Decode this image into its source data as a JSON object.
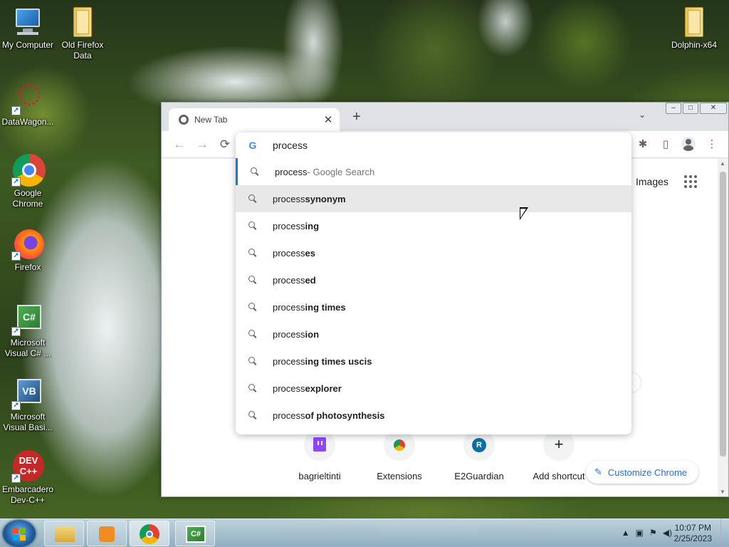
{
  "desktop": {
    "icons": [
      {
        "name": "My Computer",
        "label": "My Computer"
      },
      {
        "name": "Old Firefox Data",
        "label": "Old Firefox Data"
      },
      {
        "name": "DataWagon",
        "label": "DataWagon..."
      },
      {
        "name": "Google Chrome",
        "label": "Google Chrome"
      },
      {
        "name": "Firefox",
        "label": "Firefox"
      },
      {
        "name": "Microsoft Visual C#",
        "label": "Microsoft Visual C# ..."
      },
      {
        "name": "Microsoft Visual Basic",
        "label": "Microsoft Visual Basi..."
      },
      {
        "name": "Embarcadero Dev-C++",
        "label": "Embarcadero Dev-C++"
      },
      {
        "name": "Dolphin-x64",
        "label": "Dolphin-x64"
      }
    ]
  },
  "browser": {
    "tab_title": "New Tab",
    "tab_close": "✕",
    "new_tab": "+",
    "tab_search": "⌄",
    "window_buttons": {
      "minimize": "–",
      "maximize": "□",
      "close": "✕"
    },
    "toolbar": {
      "back": "←",
      "forward": "→",
      "reload": "⟳",
      "extensions": "✱",
      "sidepanel": "▯",
      "menu": "⋮"
    },
    "omnibox": {
      "logo": "G",
      "value": "process"
    },
    "suggestions": [
      {
        "prefix": "process",
        "bold": "",
        "suffix": " - Google Search",
        "selected": true
      },
      {
        "prefix": "process",
        "bold": " synonym",
        "suffix": "",
        "hover": true
      },
      {
        "prefix": "process",
        "bold": "ing",
        "suffix": ""
      },
      {
        "prefix": "process",
        "bold": "es",
        "suffix": ""
      },
      {
        "prefix": "process",
        "bold": "ed",
        "suffix": ""
      },
      {
        "prefix": "process",
        "bold": "ing times",
        "suffix": ""
      },
      {
        "prefix": "process",
        "bold": "ion",
        "suffix": ""
      },
      {
        "prefix": "process",
        "bold": "ing times uscis",
        "suffix": ""
      },
      {
        "prefix": "process",
        "bold": " explorer",
        "suffix": ""
      },
      {
        "prefix": "process",
        "bold": " of photosynthesis",
        "suffix": ""
      }
    ],
    "header_links": {
      "images": "Images"
    },
    "shortcuts": [
      {
        "label": "bagrieltinti",
        "icon": "twitch-icon",
        "color": "#9146ff"
      },
      {
        "label": "Extensions",
        "icon": "chrome-icon",
        "color": "#db4437"
      },
      {
        "label": "E2Guardian",
        "icon": "letter-r-icon",
        "letter": "R",
        "color": "#0b6fa4"
      },
      {
        "label": "Add shortcut",
        "icon": "plus-icon",
        "letter": "+",
        "color": "#202124"
      }
    ],
    "customize": {
      "label": "Customize Chrome",
      "icon": "✎"
    }
  },
  "taskbar": {
    "clock_time": "10:07 PM",
    "clock_date": "2/25/2023",
    "tray_up": "▲"
  },
  "colors": {
    "accent": "#1a73e8",
    "chrome_frame": "#dee1e6"
  }
}
